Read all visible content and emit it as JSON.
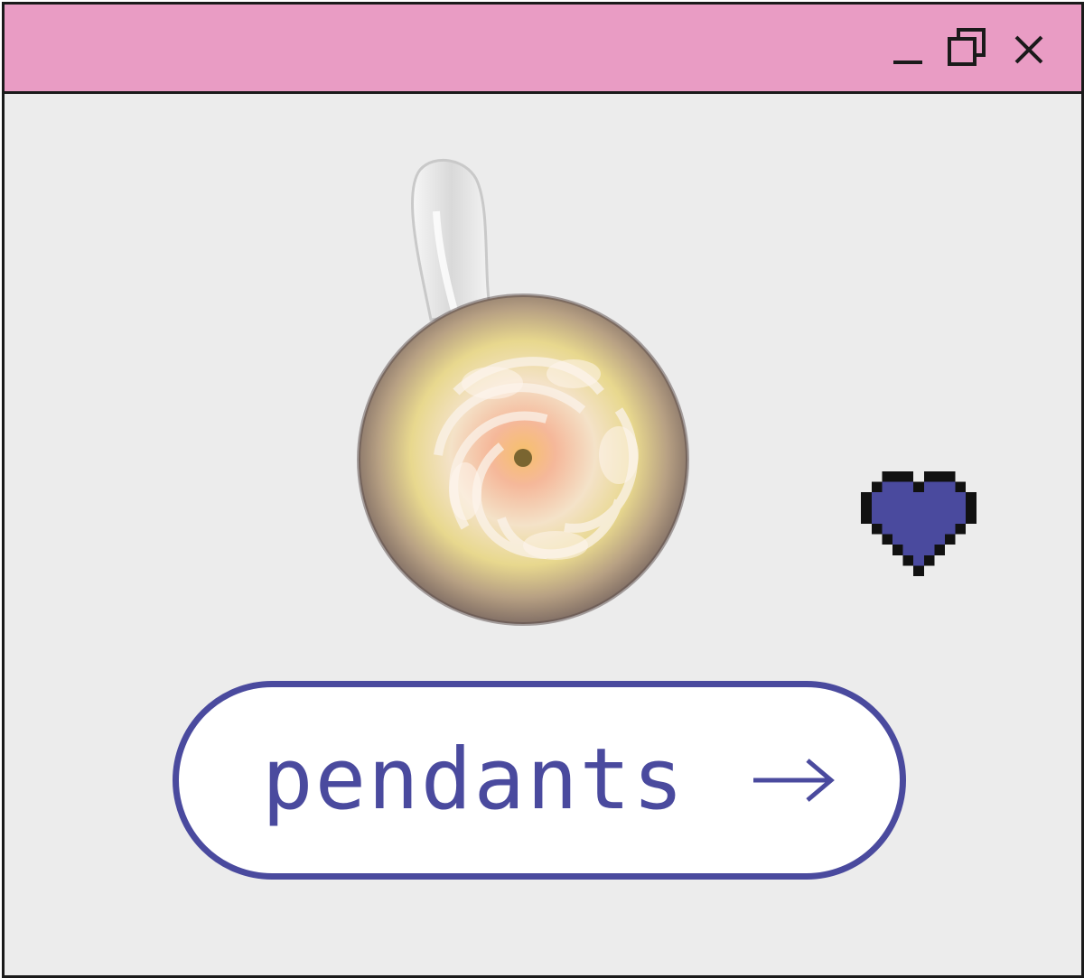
{
  "window": {
    "controls": [
      {
        "name": "minimize-icon",
        "label": "minimize"
      },
      {
        "name": "restore-icon",
        "label": "restore"
      },
      {
        "name": "close-icon",
        "label": "close"
      }
    ]
  },
  "product_image": {
    "icon": "glass-pendant-image"
  },
  "favorite": {
    "icon": "heart-icon",
    "color": "#4a4a9e"
  },
  "cta": {
    "label": "pendants",
    "arrow_icon": "arrow-right-icon"
  },
  "colors": {
    "titlebar": "#e99cc4",
    "background": "#ececec",
    "accent": "#4a4a9e",
    "border": "#1a1a1a"
  }
}
